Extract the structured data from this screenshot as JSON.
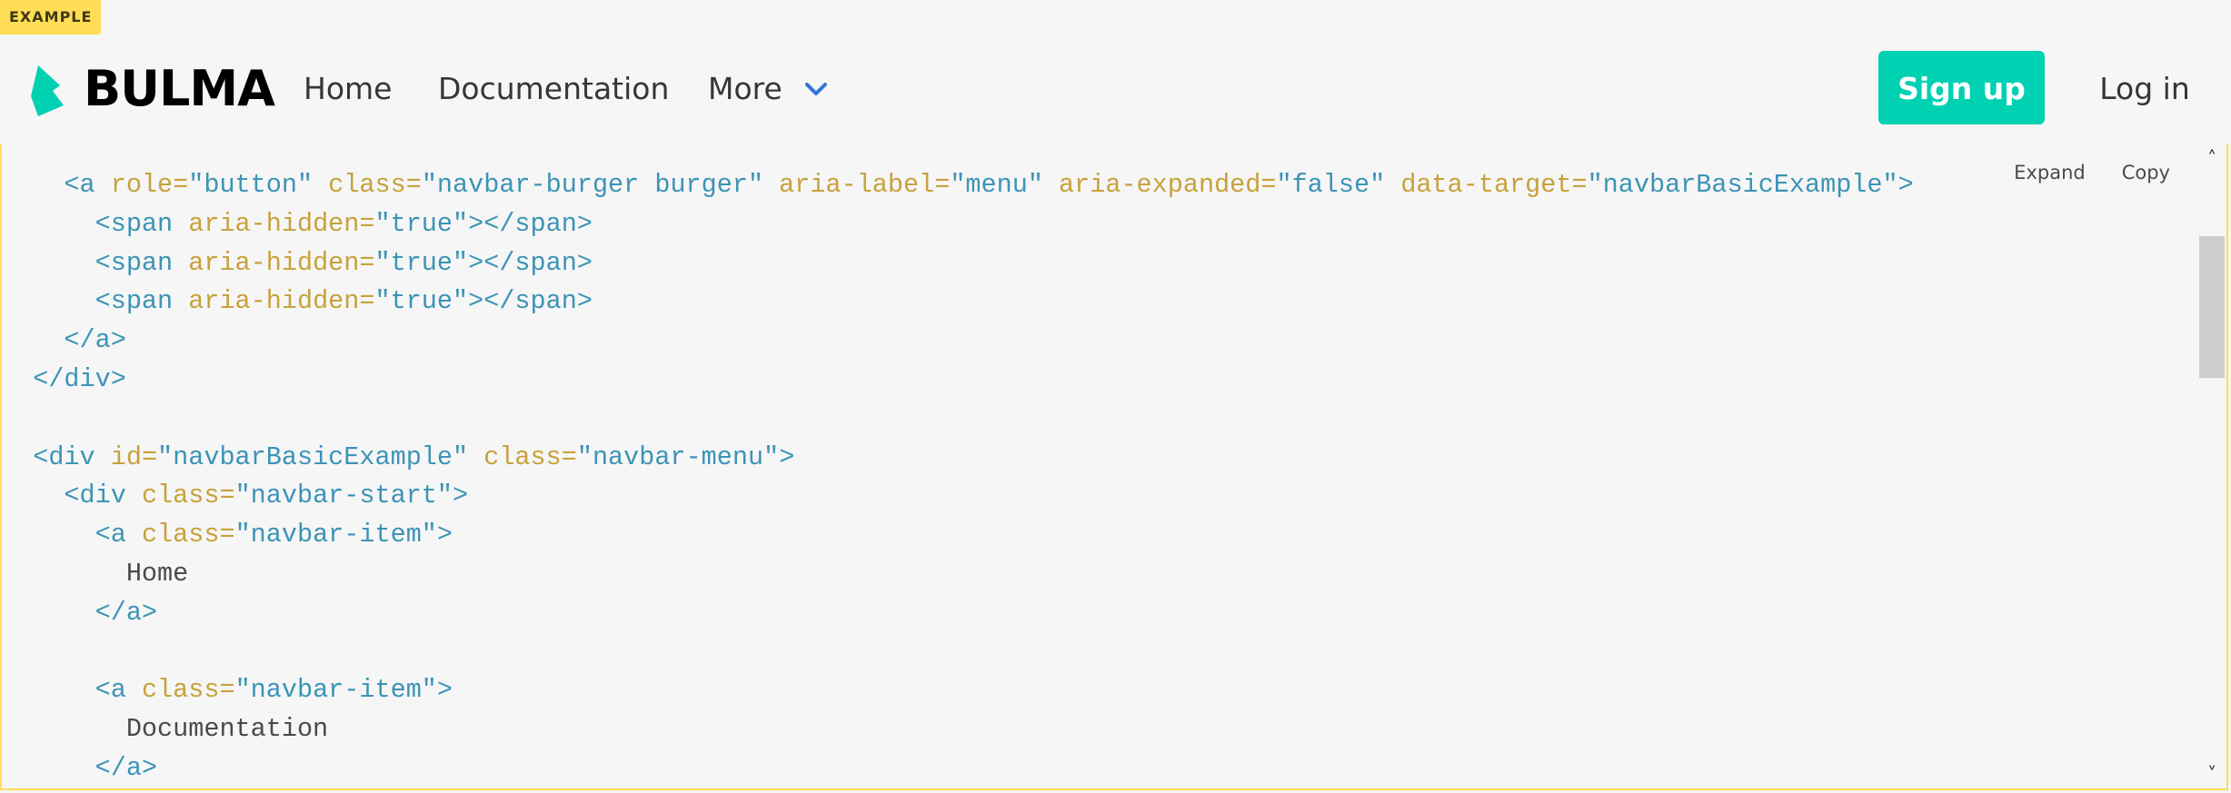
{
  "example_tag": "EXAMPLE",
  "brand": {
    "name": "BULMA",
    "logo_icon": "bulma-logo-icon",
    "logo_color": "#00d1b2"
  },
  "navbar": {
    "items": [
      {
        "label": "Home"
      },
      {
        "label": "Documentation"
      },
      {
        "label": "More",
        "icon": "chevron-down-icon"
      }
    ],
    "signup_label": "Sign up",
    "login_label": "Log in",
    "accent_color": "#00d1b2",
    "chevron_color": "#3273dc"
  },
  "code": {
    "actions": {
      "expand": "Expand",
      "copy": "Copy"
    },
    "lines": [
      {
        "parts": [
          {
            "t": "    ",
            "c": "text"
          },
          {
            "t": "<a ",
            "c": "tag"
          },
          {
            "t": "role=",
            "c": "attr"
          },
          {
            "t": "\"button\"",
            "c": "val"
          },
          {
            "t": " class=",
            "c": "attr"
          },
          {
            "t": "\"navbar-burger burger\"",
            "c": "val"
          },
          {
            "t": " aria-label=",
            "c": "attr"
          },
          {
            "t": "\"menu\"",
            "c": "val"
          },
          {
            "t": " aria-expanded=",
            "c": "attr"
          },
          {
            "t": "\"false\"",
            "c": "val"
          },
          {
            "t": " data-target=",
            "c": "attr"
          },
          {
            "t": "\"navbarBasicExample\"",
            "c": "val"
          },
          {
            "t": ">",
            "c": "tag"
          }
        ]
      },
      {
        "parts": [
          {
            "t": "      ",
            "c": "text"
          },
          {
            "t": "<span ",
            "c": "tag"
          },
          {
            "t": "aria-hidden=",
            "c": "attr"
          },
          {
            "t": "\"true\"",
            "c": "val"
          },
          {
            "t": "></span>",
            "c": "tag"
          }
        ]
      },
      {
        "parts": [
          {
            "t": "      ",
            "c": "text"
          },
          {
            "t": "<span ",
            "c": "tag"
          },
          {
            "t": "aria-hidden=",
            "c": "attr"
          },
          {
            "t": "\"true\"",
            "c": "val"
          },
          {
            "t": "></span>",
            "c": "tag"
          }
        ]
      },
      {
        "parts": [
          {
            "t": "      ",
            "c": "text"
          },
          {
            "t": "<span ",
            "c": "tag"
          },
          {
            "t": "aria-hidden=",
            "c": "attr"
          },
          {
            "t": "\"true\"",
            "c": "val"
          },
          {
            "t": "></span>",
            "c": "tag"
          }
        ]
      },
      {
        "parts": [
          {
            "t": "    ",
            "c": "text"
          },
          {
            "t": "</a>",
            "c": "tag"
          }
        ]
      },
      {
        "parts": [
          {
            "t": "  ",
            "c": "text"
          },
          {
            "t": "</div>",
            "c": "tag"
          }
        ]
      },
      {
        "parts": []
      },
      {
        "parts": [
          {
            "t": "  ",
            "c": "text"
          },
          {
            "t": "<div ",
            "c": "tag"
          },
          {
            "t": "id=",
            "c": "attr"
          },
          {
            "t": "\"navbarBasicExample\"",
            "c": "val"
          },
          {
            "t": " class=",
            "c": "attr"
          },
          {
            "t": "\"navbar-menu\"",
            "c": "val"
          },
          {
            "t": ">",
            "c": "tag"
          }
        ]
      },
      {
        "parts": [
          {
            "t": "    ",
            "c": "text"
          },
          {
            "t": "<div ",
            "c": "tag"
          },
          {
            "t": "class=",
            "c": "attr"
          },
          {
            "t": "\"navbar-start\"",
            "c": "val"
          },
          {
            "t": ">",
            "c": "tag"
          }
        ]
      },
      {
        "parts": [
          {
            "t": "      ",
            "c": "text"
          },
          {
            "t": "<a ",
            "c": "tag"
          },
          {
            "t": "class=",
            "c": "attr"
          },
          {
            "t": "\"navbar-item\"",
            "c": "val"
          },
          {
            "t": ">",
            "c": "tag"
          }
        ]
      },
      {
        "parts": [
          {
            "t": "        ",
            "c": "text"
          },
          {
            "t": "Home",
            "c": "text"
          }
        ]
      },
      {
        "parts": [
          {
            "t": "      ",
            "c": "text"
          },
          {
            "t": "</a>",
            "c": "tag"
          }
        ]
      },
      {
        "parts": []
      },
      {
        "parts": [
          {
            "t": "      ",
            "c": "text"
          },
          {
            "t": "<a ",
            "c": "tag"
          },
          {
            "t": "class=",
            "c": "attr"
          },
          {
            "t": "\"navbar-item\"",
            "c": "val"
          },
          {
            "t": ">",
            "c": "tag"
          }
        ]
      },
      {
        "parts": [
          {
            "t": "        ",
            "c": "text"
          },
          {
            "t": "Documentation",
            "c": "text"
          }
        ]
      },
      {
        "parts": [
          {
            "t": "      ",
            "c": "text"
          },
          {
            "t": "</a>",
            "c": "tag"
          }
        ]
      }
    ]
  },
  "scrollbar": {
    "up_icon": "scroll-up-arrow-icon",
    "down_icon": "scroll-down-arrow-icon",
    "up_glyph": "˄",
    "down_glyph": "˅"
  }
}
